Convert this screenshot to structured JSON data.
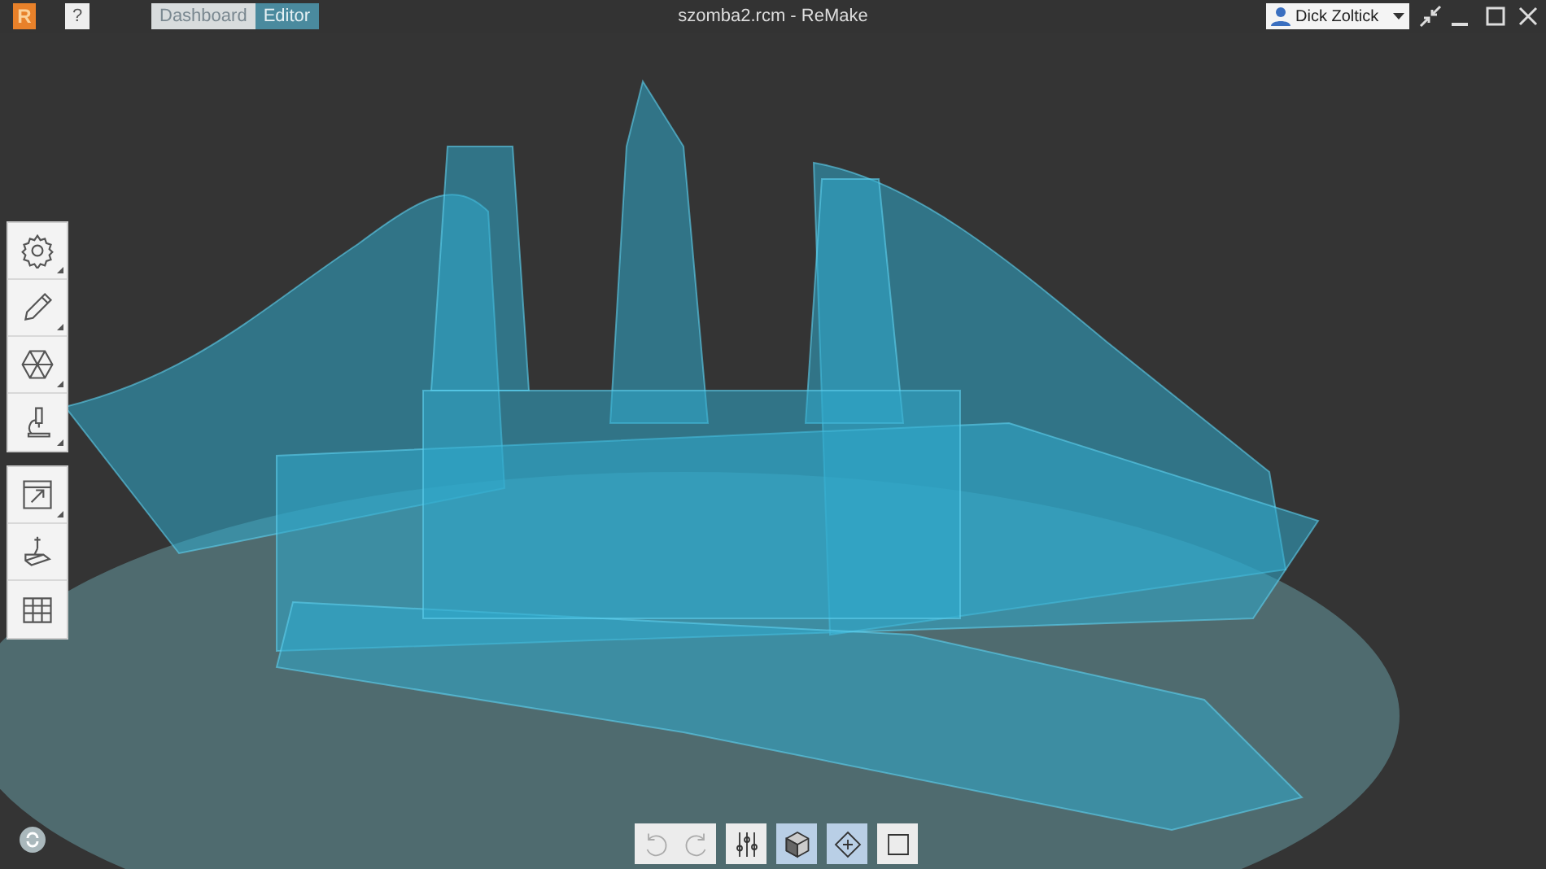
{
  "app": {
    "logo": "R",
    "help": "?"
  },
  "tabs": [
    {
      "label": "Dashboard",
      "selected": false
    },
    {
      "label": "Editor",
      "selected": true
    }
  ],
  "window": {
    "title": "szomba2.rcm - ReMake"
  },
  "user": {
    "name": "Dick Zoltick"
  },
  "left_toolbar": [
    {
      "kind": "settings",
      "has_menu": true
    },
    {
      "kind": "pencil",
      "has_menu": true
    },
    {
      "kind": "hexagon",
      "has_menu": true
    },
    {
      "kind": "microscope",
      "has_menu": true
    },
    {
      "kind": "export",
      "has_menu": true
    },
    {
      "kind": "print",
      "has_menu": false
    },
    {
      "kind": "grid",
      "has_menu": false
    }
  ],
  "bottom_toolbar": [
    {
      "kind": "undo",
      "disabled": true,
      "selected": false
    },
    {
      "kind": "redo",
      "disabled": true,
      "selected": false
    },
    {
      "kind": "sliders",
      "disabled": false,
      "selected": false
    },
    {
      "kind": "cube",
      "disabled": false,
      "selected": true
    },
    {
      "kind": "move",
      "disabled": false,
      "selected": true
    },
    {
      "kind": "crop",
      "disabled": false,
      "selected": false
    }
  ]
}
